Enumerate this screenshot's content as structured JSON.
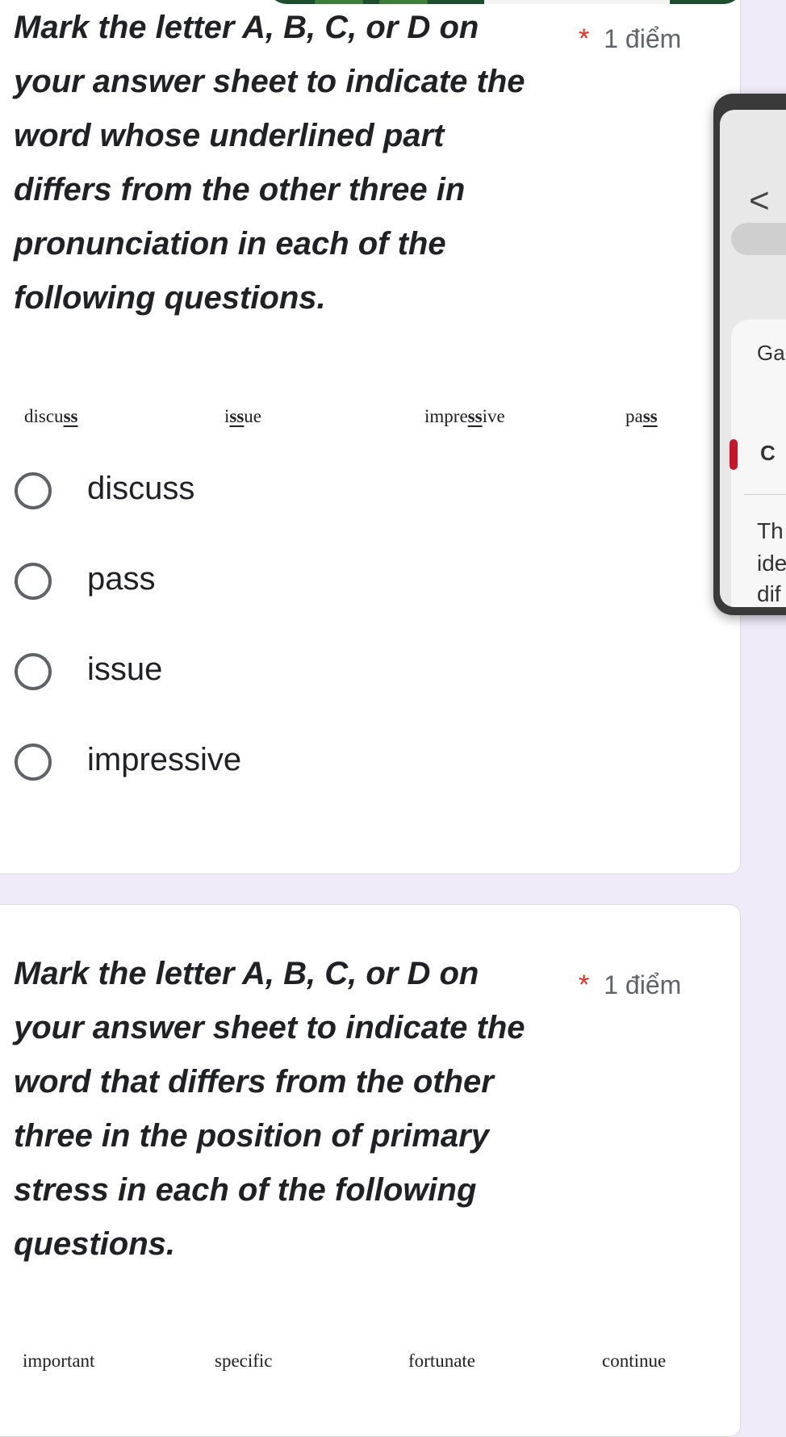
{
  "colors": {
    "background": "#f0ebf8",
    "card": "#ffffff",
    "required": "#d93025",
    "text": "#202124",
    "muted": "#5f6368"
  },
  "question1": {
    "title_lines": [
      "Mark the letter A, B, C, or D on",
      "your answer sheet to indicate the",
      "word whose underlined part",
      "differs from the other three in",
      "pronunciation in each of the",
      "following questions."
    ],
    "required_mark": "*",
    "points": "1 điểm",
    "words": [
      {
        "before": "discu",
        "underlined": "ss",
        "after": ""
      },
      {
        "before": "i",
        "underlined": "ss",
        "after": "ue"
      },
      {
        "before": "impre",
        "underlined": "ss",
        "after": "ive"
      },
      {
        "before": "pa",
        "underlined": "ss",
        "after": ""
      }
    ],
    "options": [
      "discuss",
      "pass",
      "issue",
      "impressive"
    ]
  },
  "question2": {
    "title_lines": [
      "Mark the letter A, B, C, or D on",
      "your answer sheet to indicate the",
      "word that differs from the other",
      "three in the position of primary",
      "stress in each of the following",
      "questions."
    ],
    "required_mark": "*",
    "points": "1 điểm",
    "words": [
      "important",
      "specific",
      "fortunate",
      "continue"
    ]
  },
  "overlay": {
    "back_icon": "chevron-left-icon",
    "back_glyph": "<",
    "label_top": "Ga",
    "label_c": "C",
    "lines": [
      "Th",
      "ide",
      "dif"
    ]
  }
}
